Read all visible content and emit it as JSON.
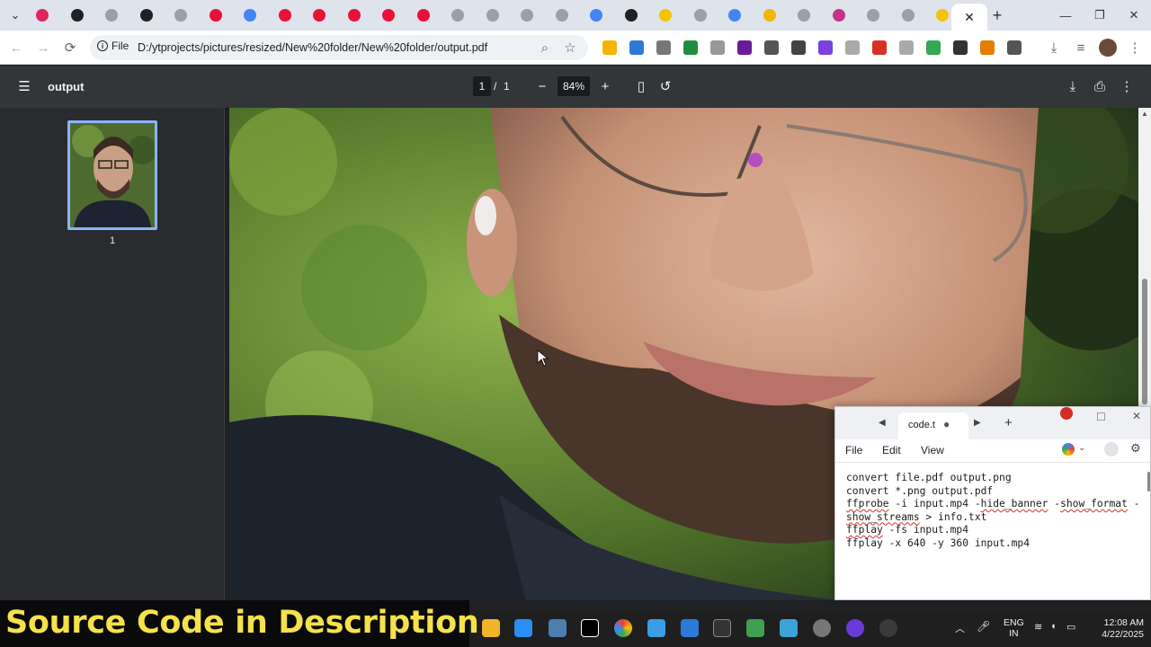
{
  "browser": {
    "tab_count_visible": 28,
    "favicon_colors": [
      "#e0245e",
      "#202124",
      "#9aa0a6",
      "#202124",
      "#9aa0a6",
      "#e8113b",
      "#4285f4",
      "#e8113b",
      "#e8113b",
      "#e8113b",
      "#e8113b",
      "#e8113b",
      "#9aa0a6",
      "#9aa0a6",
      "#9aa0a6",
      "#9aa0a6",
      "#4285f4",
      "#202124",
      "#f5c400",
      "#9aa0a6",
      "#4285f4",
      "#f5b400",
      "#9aa0a6",
      "#c13584",
      "#9aa0a6",
      "#9aa0a6",
      "#f5c400"
    ],
    "new_tab_label": "+",
    "omnibox": {
      "scheme_label": "File",
      "url": "D:/ytprojects/pictures/resized/New%20folder/New%20folder/output.pdf"
    }
  },
  "pdf_viewer": {
    "title": "output",
    "page_current": "1",
    "page_separator": "/",
    "page_total": "1",
    "zoom": "84%",
    "thumbnail_page_label": "1"
  },
  "notepad": {
    "tab_title": "code.t",
    "menu": [
      "File",
      "Edit",
      "View"
    ],
    "lines": [
      {
        "text": "convert file.pdf output.png"
      },
      {
        "text": ""
      },
      {
        "text": "convert *.png output.pdf"
      },
      {
        "text": ""
      },
      {
        "text": ""
      },
      {
        "text": "ffprobe -i input.mp4 -hide_banner -show_format -"
      },
      {
        "text": "show_streams > info.txt"
      },
      {
        "text": ""
      },
      {
        "text": "ffplay -fs input.mp4"
      },
      {
        "text": ""
      },
      {
        "text": "ffplay -x 640 -y 360 input.mp4"
      }
    ]
  },
  "taskbar": {
    "language_line1": "ENG",
    "language_line2": "IN",
    "time": "12:08 AM",
    "date": "4/22/2025"
  },
  "overlay": {
    "banner_text": "Source Code in  Description"
  },
  "colors": {
    "accent_blue": "#8ab4f8",
    "banner_yellow": "#f5e24a",
    "pdf_bar": "#323639"
  }
}
